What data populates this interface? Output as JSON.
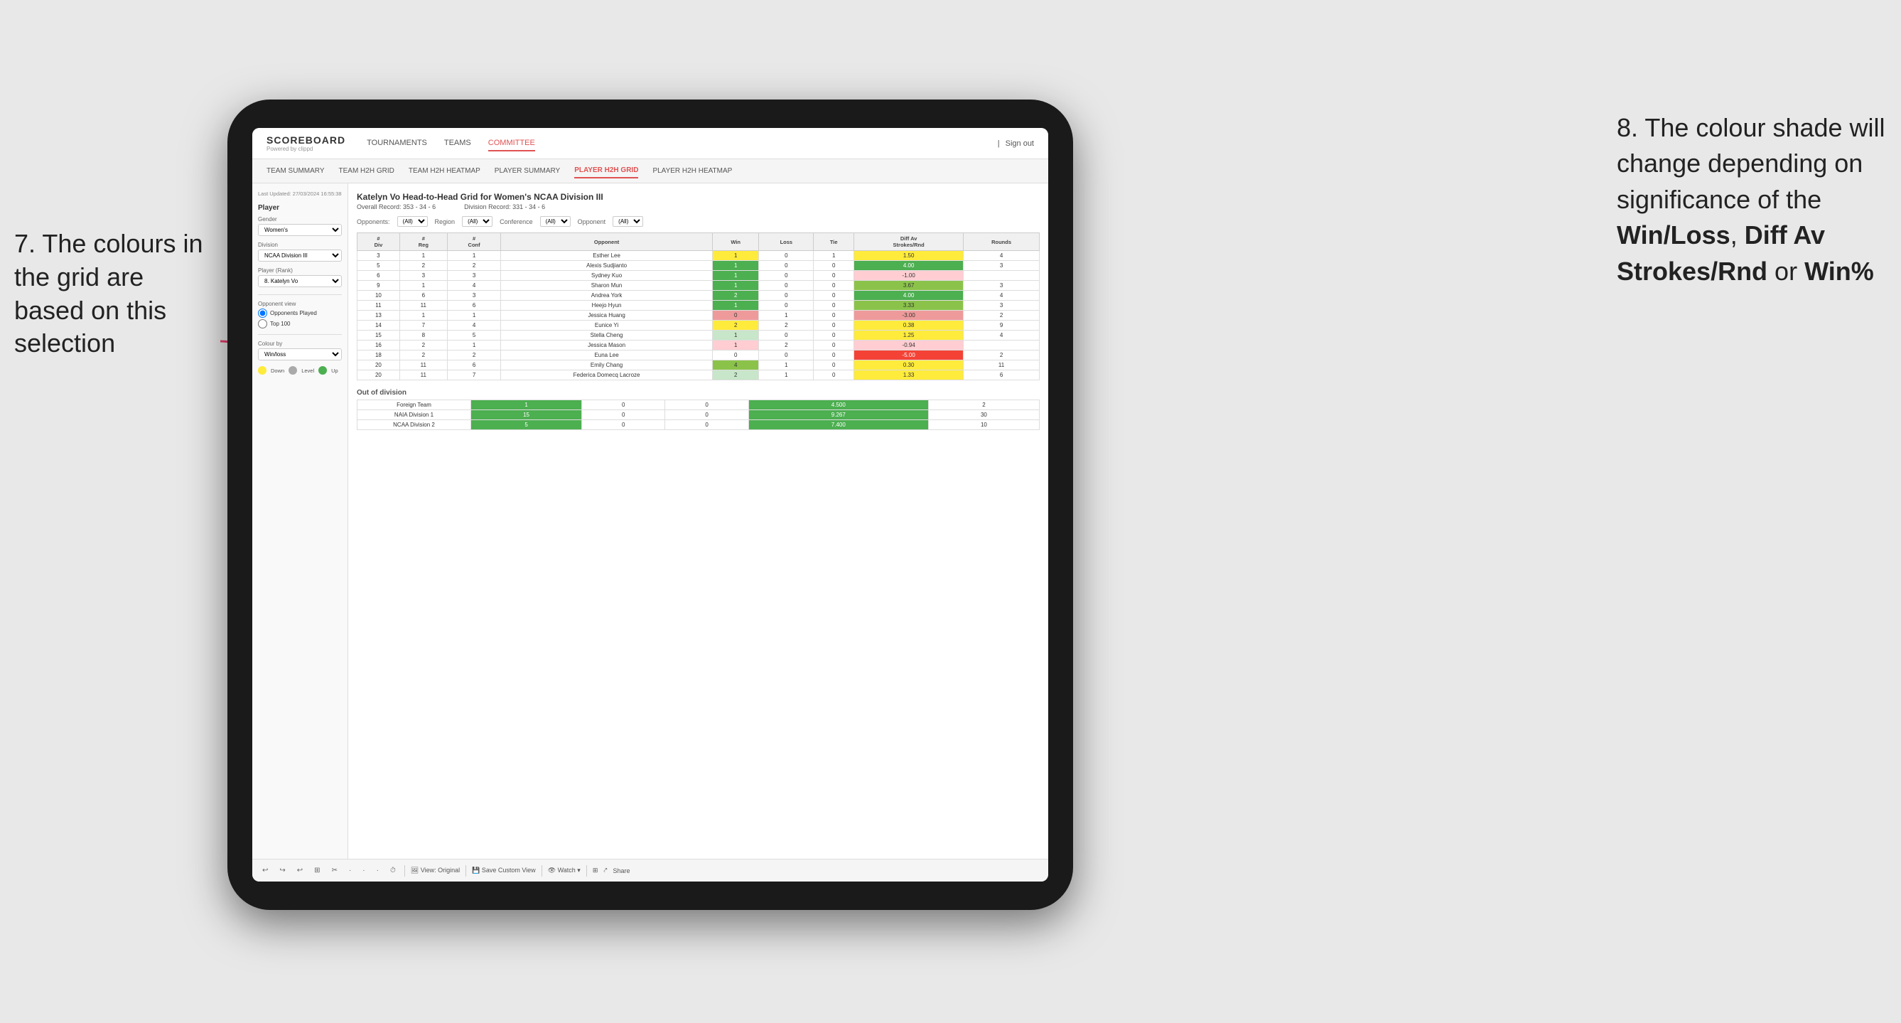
{
  "annotations": {
    "left_text": "7. The colours in the grid are based on this selection",
    "right_text_line1": "8. The colour shade will change depending on significance of the ",
    "right_bold1": "Win/Loss",
    "right_text_line2": ", ",
    "right_bold2": "Diff Av Strokes/Rnd",
    "right_text_line3": " or ",
    "right_bold3": "Win%"
  },
  "nav": {
    "logo_title": "SCOREBOARD",
    "logo_sub": "Powered by clippd",
    "links": [
      "TOURNAMENTS",
      "TEAMS",
      "COMMITTEE"
    ],
    "active_link": "COMMITTEE",
    "right_items": [
      "Sign out"
    ]
  },
  "sub_nav": {
    "links": [
      "TEAM SUMMARY",
      "TEAM H2H GRID",
      "TEAM H2H HEATMAP",
      "PLAYER SUMMARY",
      "PLAYER H2H GRID",
      "PLAYER H2H HEATMAP"
    ],
    "active_link": "PLAYER H2H GRID"
  },
  "sidebar": {
    "timestamp": "Last Updated: 27/03/2024 16:55:38",
    "section": "Player",
    "gender_label": "Gender",
    "gender_value": "Women's",
    "division_label": "Division",
    "division_value": "NCAA Division III",
    "player_rank_label": "Player (Rank)",
    "player_rank_value": "8. Katelyn Vo",
    "opponent_view_label": "Opponent view",
    "opponent_view_options": [
      "Opponents Played",
      "Top 100"
    ],
    "opponent_view_selected": "Opponents Played",
    "colour_by_label": "Colour by",
    "colour_by_value": "Win/loss",
    "legend": [
      {
        "color": "#ffeb3b",
        "label": "Down"
      },
      {
        "color": "#aaa",
        "label": "Level"
      },
      {
        "color": "#4caf50",
        "label": "Up"
      }
    ]
  },
  "grid": {
    "title": "Katelyn Vo Head-to-Head Grid for Women's NCAA Division III",
    "overall_record_label": "Overall Record:",
    "overall_record_value": "353 - 34 - 6",
    "division_record_label": "Division Record:",
    "division_record_value": "331 - 34 - 6",
    "filters": {
      "opponents_label": "Opponents:",
      "opponents_value": "(All)",
      "region_label": "Region",
      "region_value": "(All)",
      "conference_label": "Conference",
      "conference_value": "(All)",
      "opponent_label": "Opponent",
      "opponent_value": "(All)"
    },
    "table_headers": [
      "#\nDiv",
      "#\nReg",
      "#\nConf",
      "Opponent",
      "Win",
      "Loss",
      "Tie",
      "Diff Av\nStrokes/Rnd",
      "Rounds"
    ],
    "rows": [
      {
        "div": "3",
        "reg": "1",
        "conf": "1",
        "opponent": "Esther Lee",
        "win": "1",
        "loss": "0",
        "tie": "1",
        "diff": "1.50",
        "rounds": "4",
        "win_color": "yellow",
        "diff_color": "yellow"
      },
      {
        "div": "5",
        "reg": "2",
        "conf": "2",
        "opponent": "Alexis Sudjianto",
        "win": "1",
        "loss": "0",
        "tie": "0",
        "diff": "4.00",
        "rounds": "3",
        "win_color": "green-dark",
        "diff_color": "green-dark"
      },
      {
        "div": "6",
        "reg": "3",
        "conf": "3",
        "opponent": "Sydney Kuo",
        "win": "1",
        "loss": "0",
        "tie": "0",
        "diff": "-1.00",
        "rounds": "",
        "win_color": "green-dark",
        "diff_color": "red-light"
      },
      {
        "div": "9",
        "reg": "1",
        "conf": "4",
        "opponent": "Sharon Mun",
        "win": "1",
        "loss": "0",
        "tie": "0",
        "diff": "3.67",
        "rounds": "3",
        "win_color": "green-dark",
        "diff_color": "green-mid"
      },
      {
        "div": "10",
        "reg": "6",
        "conf": "3",
        "opponent": "Andrea York",
        "win": "2",
        "loss": "0",
        "tie": "0",
        "diff": "4.00",
        "rounds": "4",
        "win_color": "green-dark",
        "diff_color": "green-dark"
      },
      {
        "div": "11",
        "reg": "11",
        "conf": "6",
        "opponent": "Heejo Hyun",
        "win": "1",
        "loss": "0",
        "tie": "0",
        "diff": "3.33",
        "rounds": "3",
        "win_color": "green-dark",
        "diff_color": "green-mid"
      },
      {
        "div": "13",
        "reg": "1",
        "conf": "1",
        "opponent": "Jessica Huang",
        "win": "0",
        "loss": "1",
        "tie": "0",
        "diff": "-3.00",
        "rounds": "2",
        "win_color": "red-mid",
        "diff_color": "red-mid"
      },
      {
        "div": "14",
        "reg": "7",
        "conf": "4",
        "opponent": "Eunice Yi",
        "win": "2",
        "loss": "2",
        "tie": "0",
        "diff": "0.38",
        "rounds": "9",
        "win_color": "yellow",
        "diff_color": "yellow"
      },
      {
        "div": "15",
        "reg": "8",
        "conf": "5",
        "opponent": "Stella Cheng",
        "win": "1",
        "loss": "0",
        "tie": "0",
        "diff": "1.25",
        "rounds": "4",
        "win_color": "green-light",
        "diff_color": "yellow"
      },
      {
        "div": "16",
        "reg": "2",
        "conf": "1",
        "opponent": "Jessica Mason",
        "win": "1",
        "loss": "2",
        "tie": "0",
        "diff": "-0.94",
        "rounds": "",
        "win_color": "red-light",
        "diff_color": "red-light"
      },
      {
        "div": "18",
        "reg": "2",
        "conf": "2",
        "opponent": "Euna Lee",
        "win": "0",
        "loss": "0",
        "tie": "0",
        "diff": "-5.00",
        "rounds": "2",
        "win_color": "neutral",
        "diff_color": "red-dark"
      },
      {
        "div": "20",
        "reg": "11",
        "conf": "6",
        "opponent": "Emily Chang",
        "win": "4",
        "loss": "1",
        "tie": "0",
        "diff": "0.30",
        "rounds": "11",
        "win_color": "green-mid",
        "diff_color": "yellow"
      },
      {
        "div": "20",
        "reg": "11",
        "conf": "7",
        "opponent": "Federica Domecq Lacroze",
        "win": "2",
        "loss": "1",
        "tie": "0",
        "diff": "1.33",
        "rounds": "6",
        "win_color": "green-light",
        "diff_color": "yellow"
      }
    ],
    "out_of_division_label": "Out of division",
    "out_of_division_rows": [
      {
        "opponent": "Foreign Team",
        "win": "1",
        "loss": "0",
        "tie": "0",
        "diff": "4.500",
        "rounds": "2",
        "win_color": "green-dark",
        "diff_color": "green-dark"
      },
      {
        "opponent": "NAIA Division 1",
        "win": "15",
        "loss": "0",
        "tie": "0",
        "diff": "9.267",
        "rounds": "30",
        "win_color": "green-dark",
        "diff_color": "green-dark"
      },
      {
        "opponent": "NCAA Division 2",
        "win": "5",
        "loss": "0",
        "tie": "0",
        "diff": "7.400",
        "rounds": "10",
        "win_color": "green-dark",
        "diff_color": "green-dark"
      }
    ]
  },
  "toolbar": {
    "buttons": [
      "↩",
      "↪",
      "⟳",
      "⊞",
      "✂",
      "·",
      "·",
      "·",
      "⏱"
    ],
    "view_original": "View: Original",
    "save_custom": "Save Custom View",
    "watch": "Watch",
    "share": "Share"
  }
}
